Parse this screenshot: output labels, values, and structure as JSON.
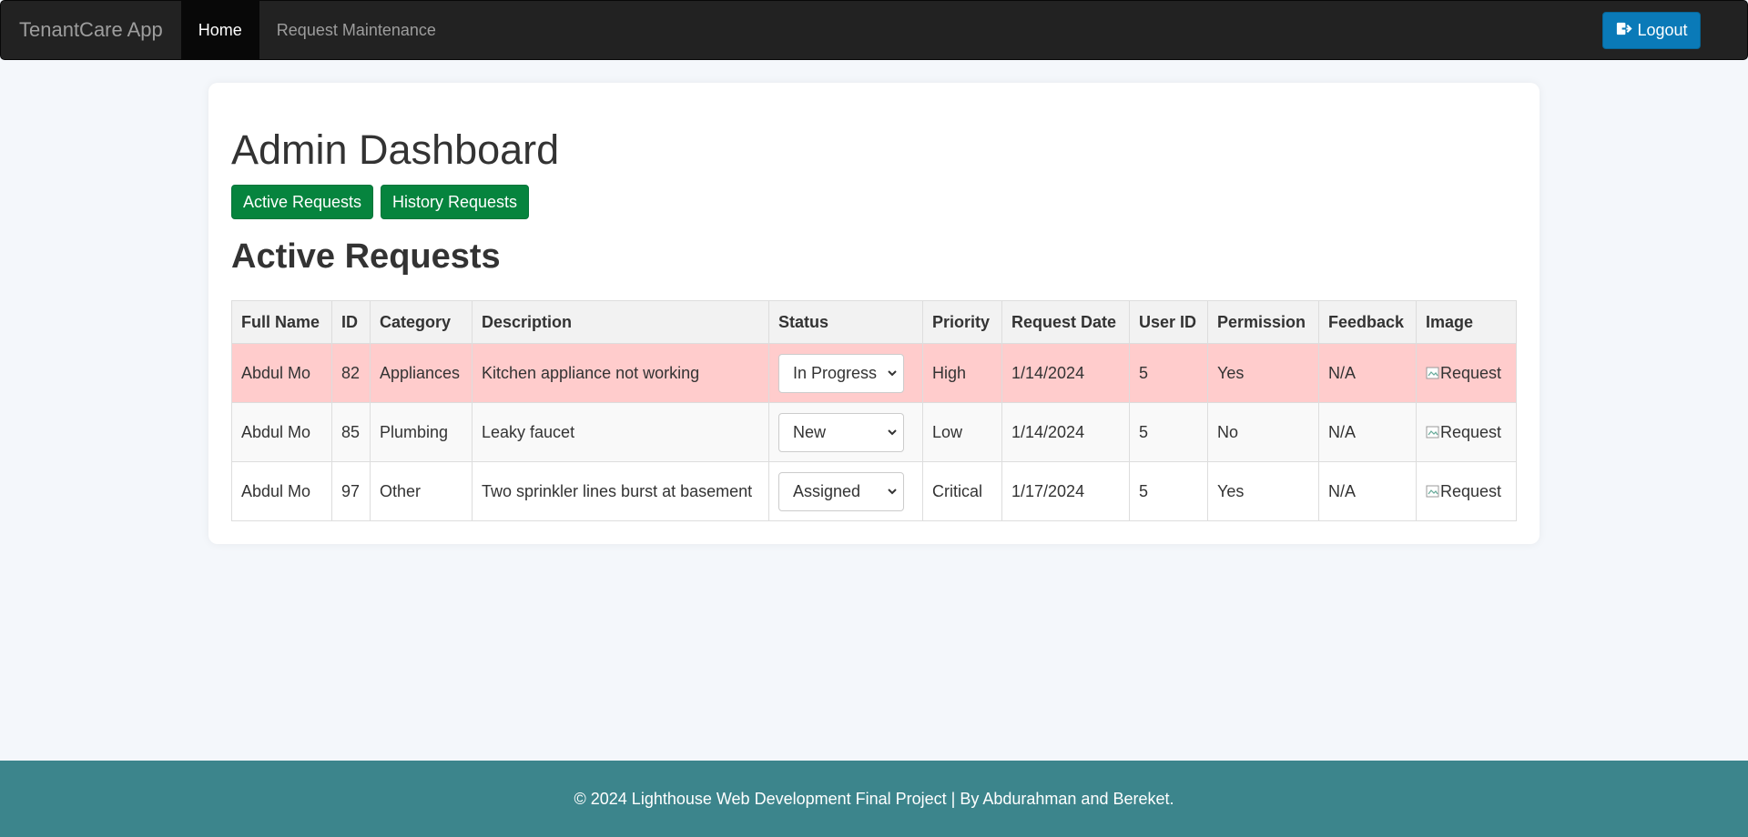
{
  "navbar": {
    "brand": "TenantCare App",
    "items": [
      {
        "label": "Home",
        "active": true
      },
      {
        "label": "Request Maintenance",
        "active": false
      }
    ],
    "logout_label": "Logout",
    "logout_icon": "sign-out-icon"
  },
  "dashboard": {
    "title": "Admin Dashboard",
    "buttons": {
      "active": "Active Requests",
      "history": "History Requests"
    },
    "section_title": "Active Requests"
  },
  "table": {
    "headers": [
      "Full Name",
      "ID",
      "Category",
      "Description",
      "Status",
      "Priority",
      "Request Date",
      "User ID",
      "Permission",
      "Feedback",
      "Image"
    ],
    "rows": [
      {
        "full_name": "Abdul Mo",
        "id": "82",
        "category": "Appliances",
        "description": "Kitchen appliance not working",
        "status": "In Progress",
        "priority": "High",
        "request_date": "1/14/2024",
        "user_id": "5",
        "permission": "Yes",
        "feedback": "N/A",
        "image_alt": "Request"
      },
      {
        "full_name": "Abdul Mo",
        "id": "85",
        "category": "Plumbing",
        "description": "Leaky faucet",
        "status": "New",
        "priority": "Low",
        "request_date": "1/14/2024",
        "user_id": "5",
        "permission": "No",
        "feedback": "N/A",
        "image_alt": "Request"
      },
      {
        "full_name": "Abdul Mo",
        "id": "97",
        "category": "Other",
        "description": "Two sprinkler lines burst at basement",
        "status": "Assigned",
        "priority": "Critical",
        "request_date": "1/17/2024",
        "user_id": "5",
        "permission": "Yes",
        "feedback": "N/A",
        "image_alt": "Request"
      }
    ]
  },
  "footer": {
    "text": "© 2024 Lighthouse Web Development Final Project | By Abdurahman and Bereket."
  },
  "colors": {
    "navbar_bg": "#222222",
    "primary_button": "#0a7ab8",
    "success_button": "#06843e",
    "high_priority_row": "#ffcccc",
    "footer_bg": "#3c858c"
  }
}
